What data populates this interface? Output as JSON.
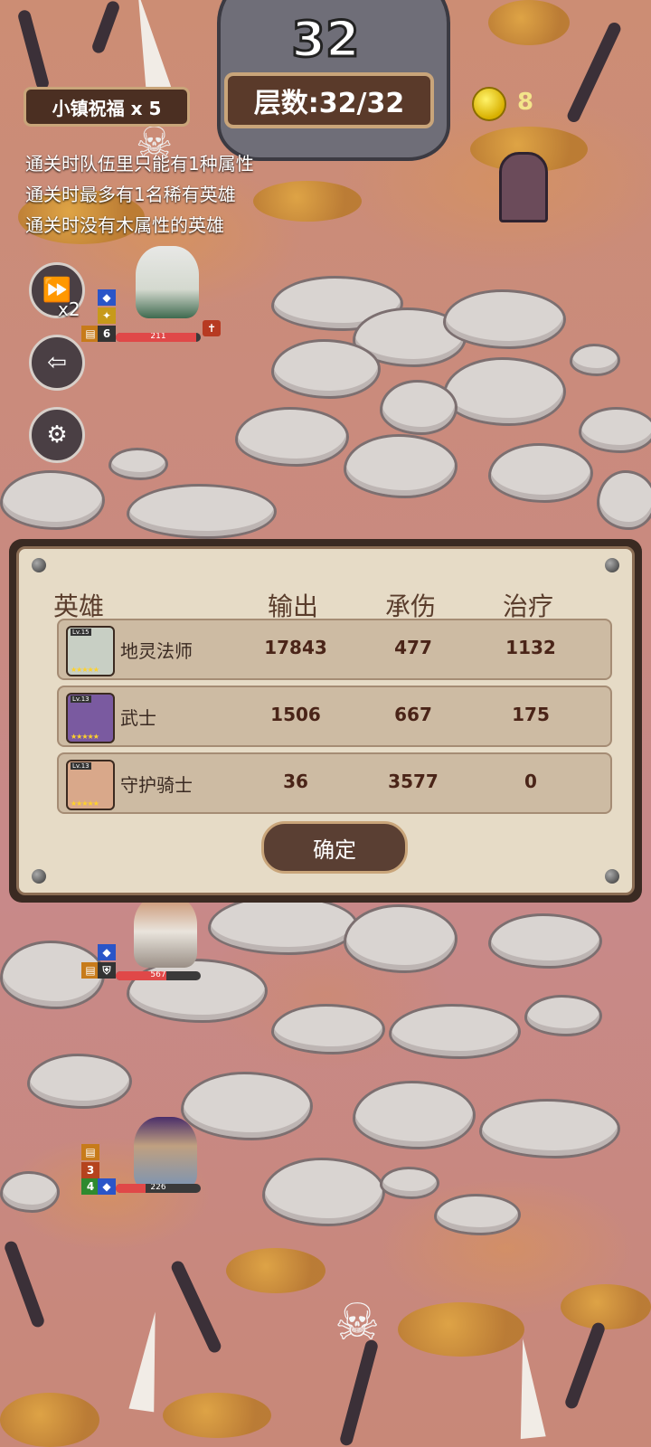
{
  "hud": {
    "level_number": "32",
    "floor_label": "层数:32/32",
    "blessing_label": "小镇祝福 x 5",
    "coins": "8",
    "speed_label": "x2"
  },
  "rules": [
    "通关时队伍里只能有1种属性",
    "通关时最多有1名稀有英雄",
    "通关时没有木属性的英雄"
  ],
  "field_units": [
    {
      "name": "地灵法师",
      "hp": "211",
      "hp_fraction": 0.95,
      "badge": "6"
    },
    {
      "name": "守护骑士",
      "hp": "567",
      "hp_fraction": 0.6
    },
    {
      "name": "武士",
      "hp": "226",
      "hp_fraction": 0.35,
      "badges": [
        "3",
        "4"
      ]
    }
  ],
  "summary": {
    "headers": {
      "hero": "英雄",
      "output": "输出",
      "taken": "承伤",
      "heal": "治疗"
    },
    "rows": [
      {
        "hero": "地灵法师",
        "output": "17843",
        "taken": "477",
        "heal": "1132",
        "level": "Lv.15",
        "stars": "★★★★★",
        "color": "#c8cfc4"
      },
      {
        "hero": "武士",
        "output": "1506",
        "taken": "667",
        "heal": "175",
        "level": "Lv.13",
        "stars": "★★★★★",
        "color": "#7a5aa0"
      },
      {
        "hero": "守护骑士",
        "output": "36",
        "taken": "3577",
        "heal": "0",
        "level": "Lv.13",
        "stars": "★★★★★",
        "color": "#d9a88a"
      }
    ],
    "confirm_label": "确定"
  },
  "icons": {
    "speed": "fast-forward-icon",
    "exit": "exit-icon",
    "settings": "gear-icon",
    "coin": "coin-icon",
    "skull": "skull-icon"
  },
  "colors": {
    "panel_bg": "#e6dbc6",
    "banner": "#5a3a2a",
    "hp": "#e04848"
  }
}
